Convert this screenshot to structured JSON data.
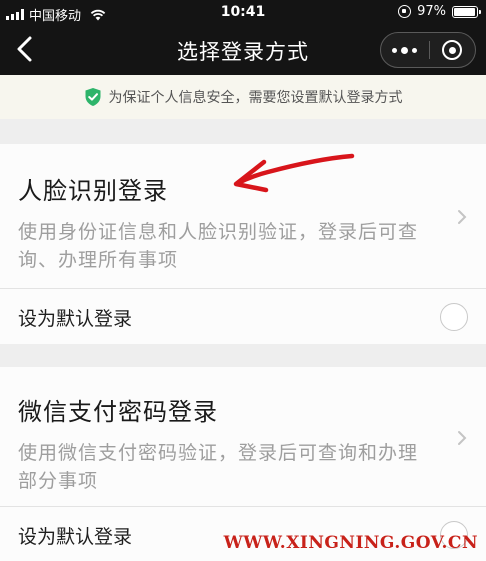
{
  "status_bar": {
    "carrier": "中国移动",
    "time": "10:41",
    "battery_text": "97%",
    "battery_level": 0.97,
    "icons": [
      "signal-icon",
      "wifi-icon",
      "orientation-lock-icon",
      "battery-icon"
    ]
  },
  "nav": {
    "title": "选择登录方式",
    "icons": [
      "back-chevron-icon",
      "more-dots-icon",
      "close-mini-program-icon"
    ]
  },
  "notice": {
    "text": "为保证个人信息安全，需要您设置默认登录方式",
    "icon": "green-shield-check-icon",
    "icon_color": "#2db46a"
  },
  "options": [
    {
      "title": "人脸识别登录",
      "description": "使用身份证信息和人脸识别验证，登录后可查询、办理所有事项",
      "default_label": "设为默认登录",
      "default_selected": false
    },
    {
      "title": "微信支付密码登录",
      "description": "使用微信支付密码验证，登录后可查询和办理部分事项",
      "default_label": "设为默认登录",
      "default_selected": false
    }
  ],
  "annotation": {
    "type": "red-arrow",
    "color": "#d8151b",
    "points_to": "人脸识别登录"
  },
  "watermark": {
    "text": "WWW.XINGNING.GOV.CN",
    "color": "#c8221a"
  }
}
